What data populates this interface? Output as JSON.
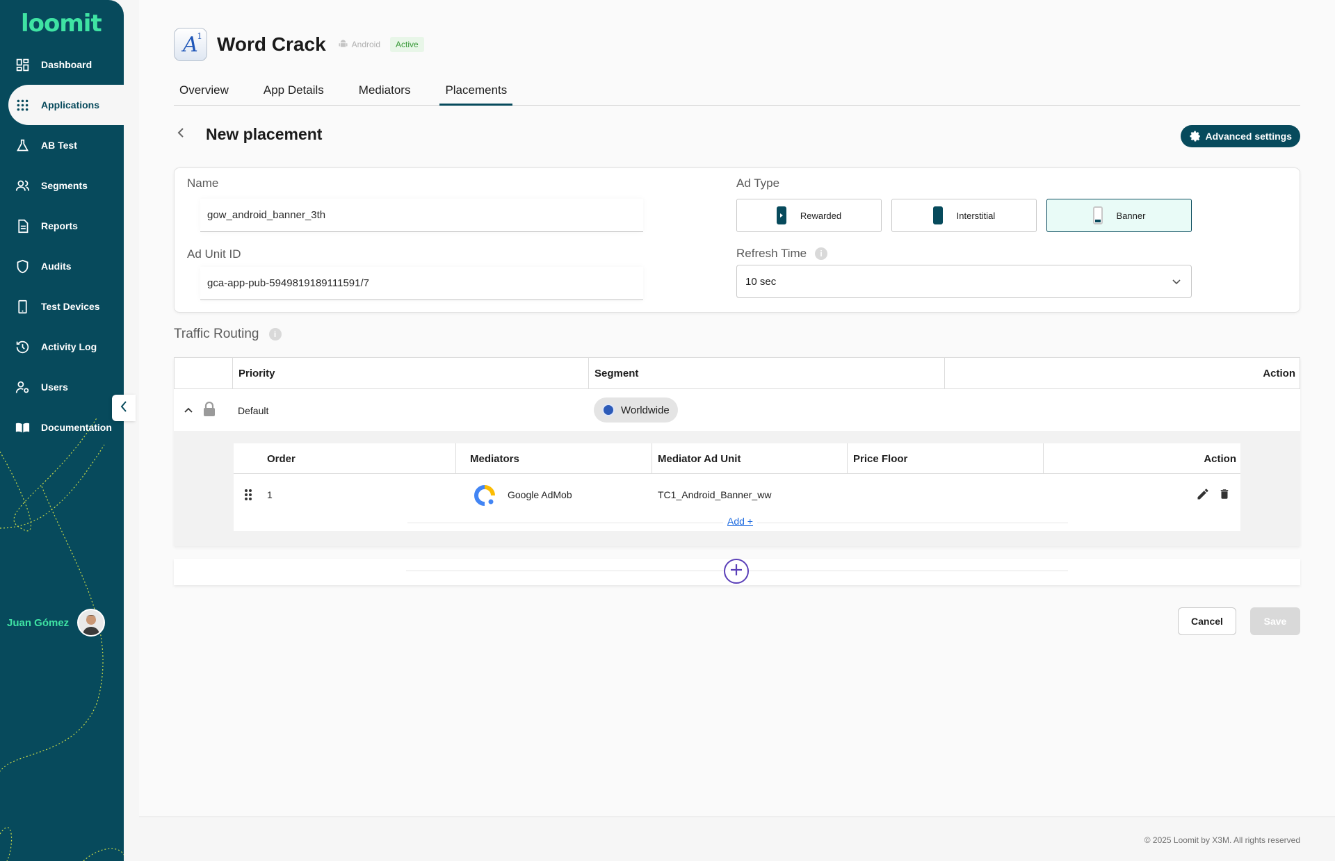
{
  "brand": {
    "logo": "loomit",
    "accent": "#3fe3a3",
    "sidebar_bg": "#074a5c"
  },
  "sidebar": {
    "items": [
      {
        "label": "Dashboard",
        "icon": "dashboard-icon"
      },
      {
        "label": "Applications",
        "icon": "grid-icon",
        "active": true
      },
      {
        "label": "AB Test",
        "icon": "flask-icon"
      },
      {
        "label": "Segments",
        "icon": "users-group-icon"
      },
      {
        "label": "Reports",
        "icon": "document-icon"
      },
      {
        "label": "Audits",
        "icon": "shield-icon"
      },
      {
        "label": "Test Devices",
        "icon": "phone-icon"
      },
      {
        "label": "Activity Log",
        "icon": "history-icon"
      },
      {
        "label": "Users",
        "icon": "user-settings-icon"
      },
      {
        "label": "Documentation",
        "icon": "book-icon"
      }
    ],
    "user_name": "Juan Gómez"
  },
  "app": {
    "name": "Word Crack",
    "platform": "Android",
    "status": "Active"
  },
  "tabs": [
    "Overview",
    "App Details",
    "Mediators",
    "Placements"
  ],
  "active_tab": "Placements",
  "page": {
    "title": "New placement",
    "advanced_settings": "Advanced settings"
  },
  "form": {
    "name_label": "Name",
    "name_value": "gow_android_banner_3th",
    "ad_unit_label": "Ad Unit ID",
    "ad_unit_value": "gca-app-pub-5949819189111591/7",
    "ad_type_label": "Ad Type",
    "ad_types": [
      "Rewarded",
      "Interstitial",
      "Banner"
    ],
    "ad_type_selected": "Banner",
    "refresh_label": "Refresh Time",
    "refresh_value": "10 sec"
  },
  "routing": {
    "title": "Traffic Routing",
    "headers": {
      "priority": "Priority",
      "segment": "Segment",
      "action": "Action"
    },
    "row": {
      "priority": "Default",
      "segment": "Worldwide"
    },
    "inner_headers": {
      "order": "Order",
      "mediators": "Mediators",
      "ad_unit": "Mediator Ad Unit",
      "price_floor": "Price Floor",
      "action": "Action"
    },
    "inner_row": {
      "order": "1",
      "mediator": "Google AdMob",
      "ad_unit": "TC1_Android_Banner_ww",
      "price_floor": ""
    },
    "add_label": "Add +"
  },
  "buttons": {
    "cancel": "Cancel",
    "save": "Save"
  },
  "footer": "© 2025 Loomit by X3M. All rights reserved"
}
